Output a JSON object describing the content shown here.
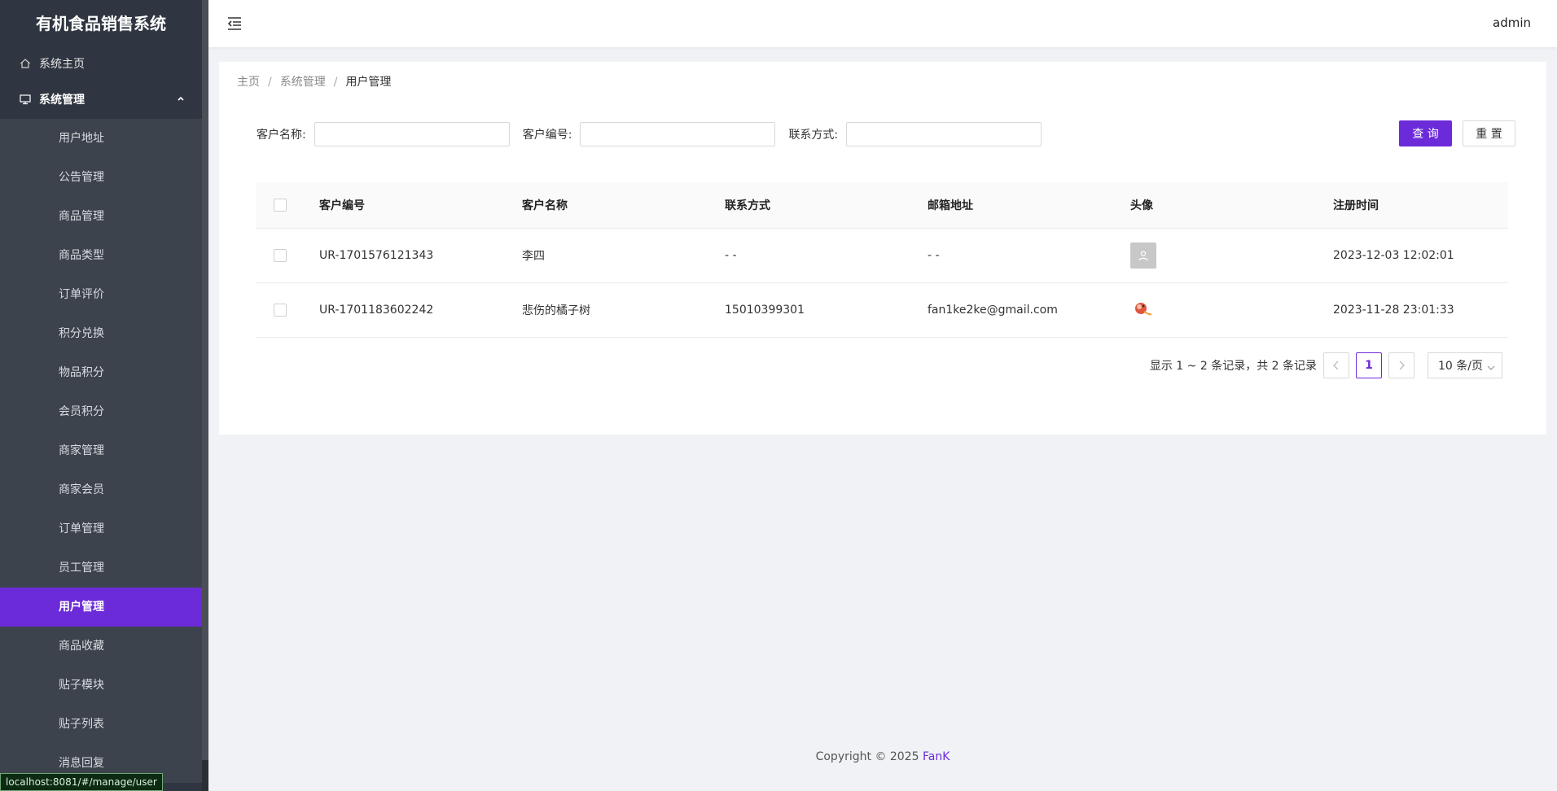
{
  "app": {
    "title": "有机食品销售系统"
  },
  "sidebar": {
    "home_label": "系统主页",
    "group_label": "系统管理",
    "items": [
      {
        "label": "用户地址"
      },
      {
        "label": "公告管理"
      },
      {
        "label": "商品管理"
      },
      {
        "label": "商品类型"
      },
      {
        "label": "订单评价"
      },
      {
        "label": "积分兑换"
      },
      {
        "label": "物品积分"
      },
      {
        "label": "会员积分"
      },
      {
        "label": "商家管理"
      },
      {
        "label": "商家会员"
      },
      {
        "label": "订单管理"
      },
      {
        "label": "员工管理"
      },
      {
        "label": "用户管理",
        "active": true
      },
      {
        "label": "商品收藏"
      },
      {
        "label": "贴子模块"
      },
      {
        "label": "贴子列表"
      },
      {
        "label": "消息回复"
      }
    ]
  },
  "status_url": "localhost:8081/#/manage/user",
  "header": {
    "user": "admin"
  },
  "breadcrumb": {
    "items": [
      "主页",
      "系统管理",
      "用户管理"
    ],
    "separator": "/"
  },
  "search": {
    "name_label": "客户名称:",
    "name_value": "",
    "code_label": "客户编号:",
    "code_value": "",
    "contact_label": "联系方式:",
    "contact_value": "",
    "query_label": "查 询",
    "reset_label": "重 置"
  },
  "table": {
    "columns": [
      "客户编号",
      "客户名称",
      "联系方式",
      "邮箱地址",
      "头像",
      "注册时间"
    ],
    "rows": [
      {
        "code": "UR-1701576121343",
        "name": "李四",
        "contact": "- -",
        "email": "- -",
        "avatar": "default-avatar-icon",
        "registered": "2023-12-03 12:02:01"
      },
      {
        "code": "UR-1701183602242",
        "name": "悲伤的橘子树",
        "contact": "15010399301",
        "email": "fan1ke2ke@gmail.com",
        "avatar": "user-photo",
        "registered": "2023-11-28 23:01:33"
      }
    ]
  },
  "pagination": {
    "summary": "显示 1 ~ 2 条记录，共 2 条记录",
    "current_page": "1",
    "page_size": "10 条/页"
  },
  "footer": {
    "copyright": "Copyright © 2025",
    "author": "FanK"
  },
  "colors": {
    "accent": "#6c2bd9",
    "sidebar_bg": "#303641",
    "submenu_bg": "#3d434d"
  }
}
